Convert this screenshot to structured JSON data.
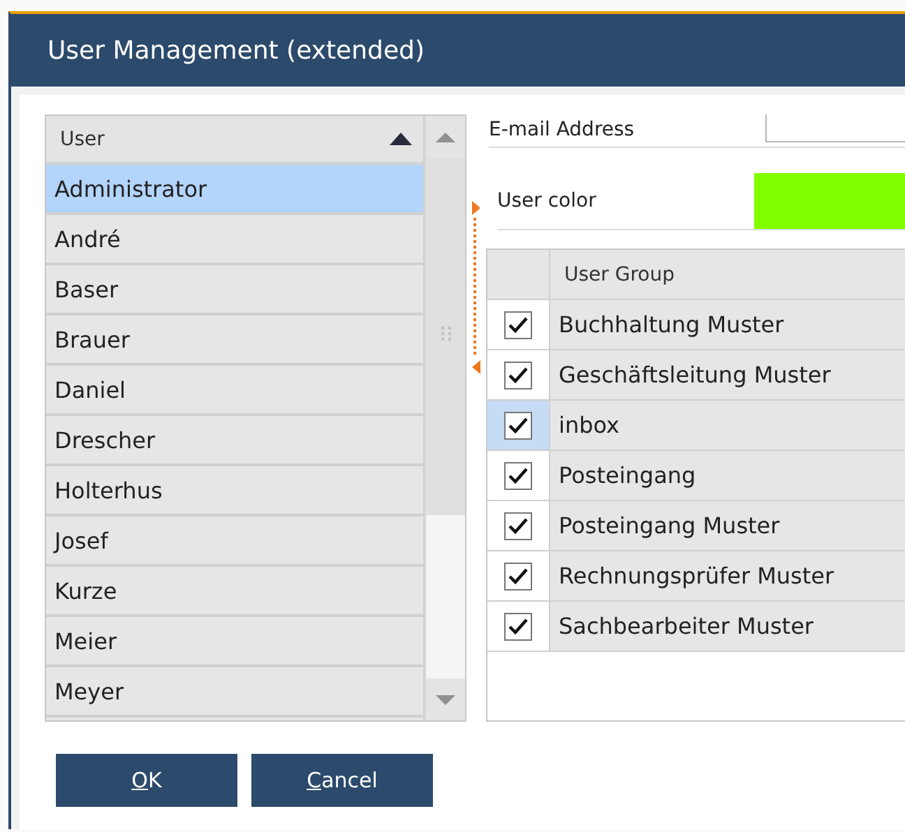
{
  "window": {
    "title": "User Management (extended)"
  },
  "user_list": {
    "columns": [
      {
        "label": "User",
        "sort_ascending": true
      }
    ],
    "rows": [
      {
        "name": "Administrator",
        "selected": true
      },
      {
        "name": "André",
        "selected": false
      },
      {
        "name": "Baser",
        "selected": false
      },
      {
        "name": "Brauer",
        "selected": false
      },
      {
        "name": "Daniel",
        "selected": false
      },
      {
        "name": "Drescher",
        "selected": false
      },
      {
        "name": "Holterhus",
        "selected": false
      },
      {
        "name": "Josef",
        "selected": false
      },
      {
        "name": "Kurze",
        "selected": false
      },
      {
        "name": "Meier",
        "selected": false
      },
      {
        "name": "Meyer",
        "selected": false
      }
    ]
  },
  "fields": [
    {
      "kind": "text",
      "label": "E-mail Address"
    },
    {
      "kind": "color",
      "label": "User color",
      "color": "#80ff00"
    }
  ],
  "group_table": {
    "columns": [
      {
        "label": "User Group"
      }
    ],
    "rows": [
      {
        "name": "Buchhaltung Muster",
        "checked": true,
        "focused": false
      },
      {
        "name": "Geschäftsleitung Muster",
        "checked": true,
        "focused": false
      },
      {
        "name": "inbox",
        "checked": true,
        "focused": true
      },
      {
        "name": "Posteingang",
        "checked": true,
        "focused": false
      },
      {
        "name": "Posteingang Muster",
        "checked": true,
        "focused": false
      },
      {
        "name": "Rechnungsprüfer Muster",
        "checked": true,
        "focused": false
      },
      {
        "name": "Sachbearbeiter Muster",
        "checked": true,
        "focused": false
      }
    ]
  },
  "buttons": [
    {
      "label": "OK"
    },
    {
      "label": "Cancel"
    }
  ]
}
